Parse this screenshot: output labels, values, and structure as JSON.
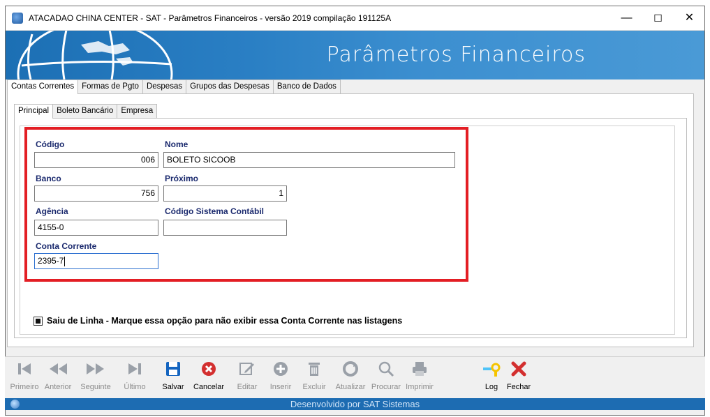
{
  "window": {
    "title": "ATACADAO CHINA CENTER - SAT - Parâmetros Financeiros - versão 2019 compilação 191125A",
    "minimize": "—",
    "maximize": "☐",
    "close": "✕"
  },
  "banner": {
    "title": "Parâmetros Financeiros"
  },
  "main_tabs": [
    {
      "label": "Contas Correntes",
      "active": true
    },
    {
      "label": "Formas de Pgto",
      "active": false
    },
    {
      "label": "Despesas",
      "active": false
    },
    {
      "label": "Grupos das Despesas",
      "active": false
    },
    {
      "label": "Banco de Dados",
      "active": false
    }
  ],
  "sub_tabs": [
    {
      "label": "Principal",
      "active": true
    },
    {
      "label": "Boleto Bancário",
      "active": false
    },
    {
      "label": "Empresa",
      "active": false
    }
  ],
  "form": {
    "codigo": {
      "label": "Código",
      "value": "006"
    },
    "nome": {
      "label": "Nome",
      "value": "BOLETO SICOOB"
    },
    "banco": {
      "label": "Banco",
      "value": "756"
    },
    "proximo": {
      "label": "Próximo",
      "value": "1"
    },
    "agencia": {
      "label": "Agência",
      "value": "4155-0"
    },
    "codigo_contabil": {
      "label": "Código Sistema Contábil",
      "value": ""
    },
    "conta_corrente": {
      "label": "Conta Corrente",
      "value": "2395-7"
    }
  },
  "saiu_de_linha": {
    "checked": true,
    "label": "Saiu de Linha - Marque essa opção para não exibir essa Conta Corrente nas listagens"
  },
  "toolbar": [
    {
      "label": "Primeiro",
      "icon": "first-icon",
      "enabled": false
    },
    {
      "label": "Anterior",
      "icon": "previous-icon",
      "enabled": false
    },
    {
      "label": "Seguinte",
      "icon": "next-icon",
      "enabled": false
    },
    {
      "label": "Último",
      "icon": "last-icon",
      "enabled": false
    },
    {
      "label": "Salvar",
      "icon": "save-icon",
      "enabled": true
    },
    {
      "label": "Cancelar",
      "icon": "cancel-icon",
      "enabled": true
    },
    {
      "label": "Editar",
      "icon": "edit-icon",
      "enabled": false
    },
    {
      "label": "Inserir",
      "icon": "insert-icon",
      "enabled": false
    },
    {
      "label": "Excluir",
      "icon": "delete-icon",
      "enabled": false
    },
    {
      "label": "Atualizar",
      "icon": "refresh-icon",
      "enabled": false
    },
    {
      "label": "Procurar",
      "icon": "search-icon",
      "enabled": false
    },
    {
      "label": "Imprimir",
      "icon": "print-icon",
      "enabled": false
    },
    {
      "label": "Log",
      "icon": "log-key-icon",
      "enabled": true
    },
    {
      "label": "Fechar",
      "icon": "close-icon",
      "enabled": true
    }
  ],
  "footer": {
    "text": "Desenvolvido por SAT Sistemas"
  },
  "colors": {
    "banner_blue": "#2a7fc4",
    "label_navy": "#1b2a6e",
    "highlight_red": "#e31e24",
    "save_blue": "#1565c0",
    "cancel_red": "#d32f2f",
    "footer_blue": "#1d6cb2"
  }
}
